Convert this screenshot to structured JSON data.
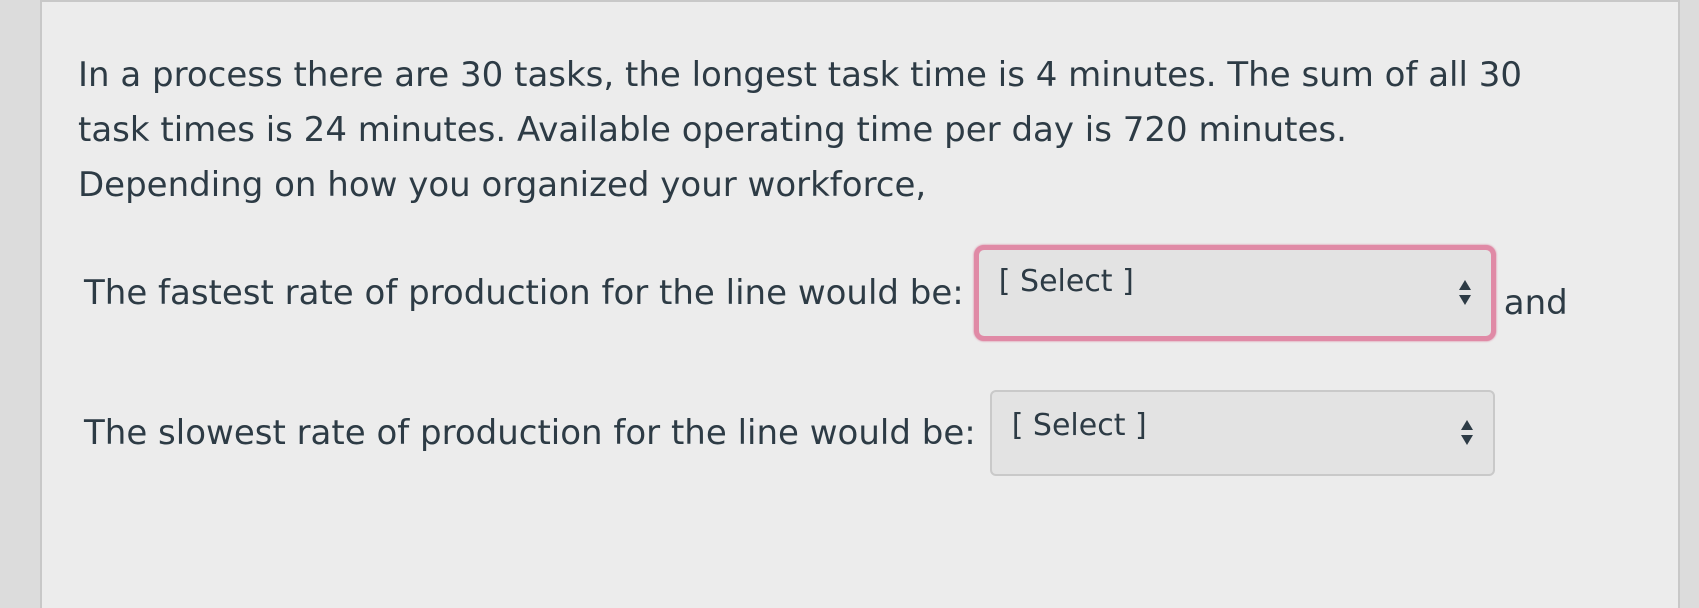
{
  "question": {
    "text": "In a process there are 30 tasks, the longest task time is 4 minutes. The sum of all 30 task times is 24 minutes. Available operating time per day is 720 minutes.  Depending on how you organized your workforce,"
  },
  "fastest": {
    "label": "The fastest rate of production for the line would be:",
    "selected": "[ Select ]",
    "trailing": "and"
  },
  "slowest": {
    "label": "The slowest rate of production for the line would be:",
    "selected": "[ Select ]"
  },
  "colors": {
    "focus_ring": "#e08aa6",
    "text": "#2d3b45",
    "panel_bg": "#ececec",
    "select_bg": "#e3e3e3"
  }
}
